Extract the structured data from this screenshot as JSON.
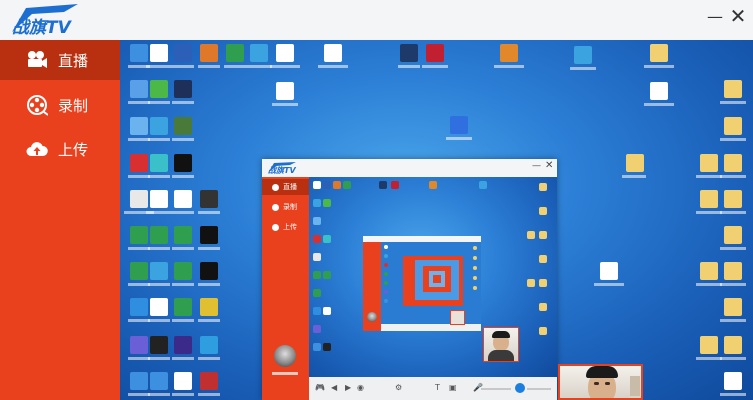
{
  "app": {
    "logo_text": "战旗TV",
    "colors": {
      "brand": "#e9401d",
      "brand_dark": "#b8300f",
      "titlebar": "#f4f5f7"
    }
  },
  "window_controls": {
    "minimize": "—",
    "close": "✕"
  },
  "sidebar": {
    "items": [
      {
        "label": "直播",
        "icon": "video-camera-icon",
        "active": true
      },
      {
        "label": "录制",
        "icon": "film-reel-icon",
        "active": false
      },
      {
        "label": "上传",
        "icon": "cloud-upload-icon",
        "active": false
      }
    ]
  },
  "preview": {
    "description_icons": "desktop-icons",
    "nested_sidebar": [
      "直播",
      "录制",
      "上传"
    ]
  }
}
